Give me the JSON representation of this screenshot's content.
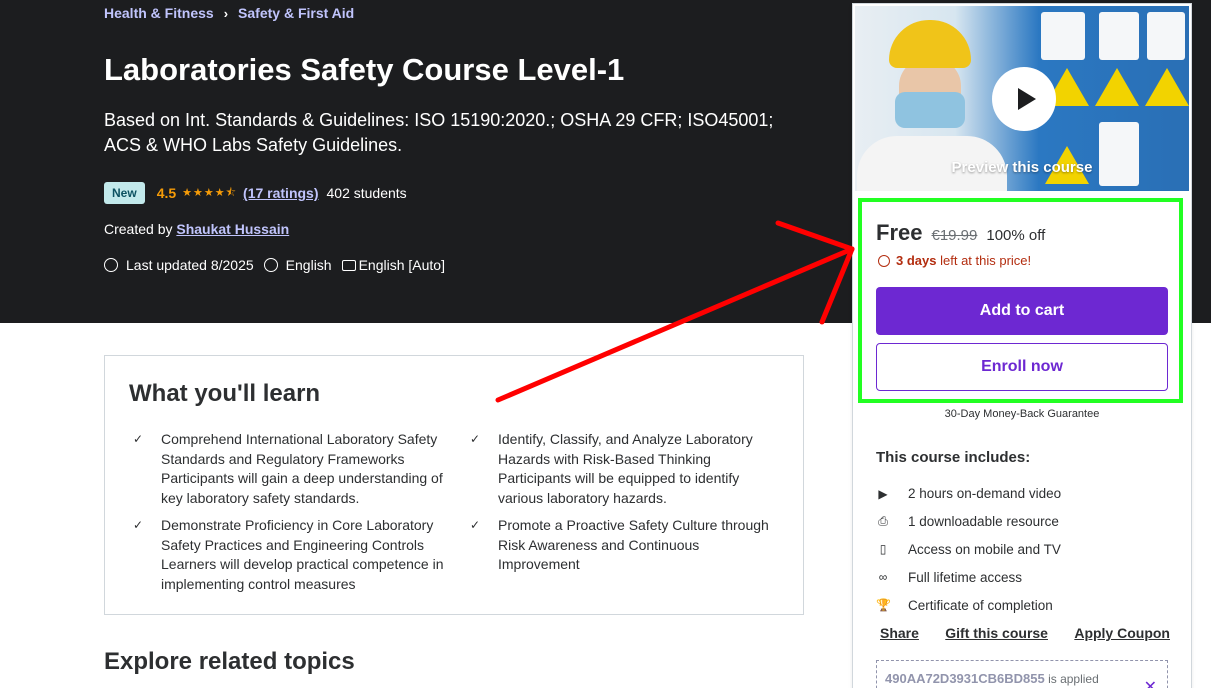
{
  "breadcrumb": {
    "items": [
      "Health & Fitness",
      "Safety & First Aid"
    ],
    "separator": "›"
  },
  "course": {
    "title": "Laboratories Safety Course Level-1",
    "subtitle": "Based on Int. Standards & Guidelines: ISO 15190:2020.; OSHA 29 CFR; ISO45001; ACS & WHO Labs Safety Guidelines.",
    "badge": "New",
    "rating": "4.5",
    "stars": "★★★★⯪",
    "ratings_text": "(17 ratings)",
    "students": "402 students",
    "created_by_label": "Created by",
    "author": "Shaukat Hussain",
    "last_updated": "Last updated 8/2025",
    "language": "English",
    "captions": "English [Auto]"
  },
  "learn": {
    "title": "What you'll learn",
    "items": [
      "Comprehend International Laboratory Safety Standards and Regulatory Frameworks Participants will gain a deep understanding of key laboratory safety standards.",
      "Identify, Classify, and Analyze Laboratory Hazards with Risk-Based Thinking Participants will be equipped to identify various laboratory hazards.",
      "Demonstrate Proficiency in Core Laboratory Safety Practices and Engineering Controls Learners will develop practical competence in implementing control measures",
      "Promote a Proactive Safety Culture through Risk Awareness and Continuous Improvement"
    ]
  },
  "related_title": "Explore related topics",
  "sidebar": {
    "preview_label": "Preview this course",
    "price": "Free",
    "old_price": "€19.99",
    "discount": "100% off",
    "timer_days": "3 days",
    "timer_rest": "left at this price!",
    "add_to_cart": "Add to cart",
    "enroll_now": "Enroll now",
    "guarantee": "30-Day Money-Back Guarantee",
    "includes_title": "This course includes:",
    "includes": [
      {
        "icon": "video-icon",
        "glyph": "▶",
        "text": "2 hours on-demand video"
      },
      {
        "icon": "file-download-icon",
        "glyph": "⎙",
        "text": "1 downloadable resource"
      },
      {
        "icon": "mobile-icon",
        "glyph": "▯",
        "text": "Access on mobile and TV"
      },
      {
        "icon": "infinity-icon",
        "glyph": "∞",
        "text": "Full lifetime access"
      },
      {
        "icon": "trophy-icon",
        "glyph": "🏆",
        "text": "Certificate of completion"
      }
    ],
    "share": "Share",
    "gift": "Gift this course",
    "apply_coupon": "Apply Coupon",
    "coupon_code": "490AA72D3931CB6BD855",
    "coupon_applied": "is applied"
  },
  "annotation_colors": {
    "highlight_box": "#22ff22",
    "arrow": "#ff0000"
  },
  "colors": {
    "brand_purple": "#6d28d2",
    "hero_bg": "#1c1d1f",
    "link_purple": "#c0c4fc",
    "star_orange": "#f69c08",
    "timer_red": "#b32d0f"
  }
}
